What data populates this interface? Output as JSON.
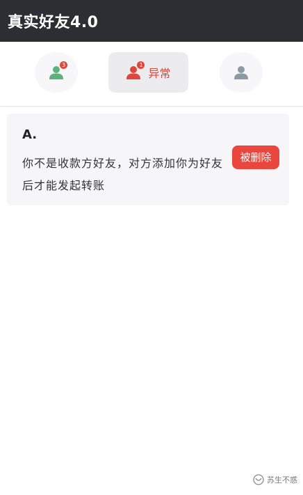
{
  "app_bar": {
    "title": "真实好友4.0"
  },
  "tabs": [
    {
      "icon": "person-icon",
      "badge": "3",
      "color": "#5bb27d"
    },
    {
      "icon": "person-icon",
      "badge": "1",
      "label": "异常",
      "color": "#e0463c"
    },
    {
      "icon": "person-icon",
      "color": "#8a9ba6"
    }
  ],
  "card": {
    "title": "A.",
    "message": "你不是收款方好友，对方添加你为好友后才能发起转账",
    "status_button": "被删除"
  },
  "watermark": {
    "text": "苏生不惑",
    "icon": "wechat-channel-icon"
  },
  "colors": {
    "app_bar": "#2b2e32",
    "accent_red": "#e0463c",
    "friend_green": "#5bb27d",
    "me_gray": "#8a9ba6"
  }
}
